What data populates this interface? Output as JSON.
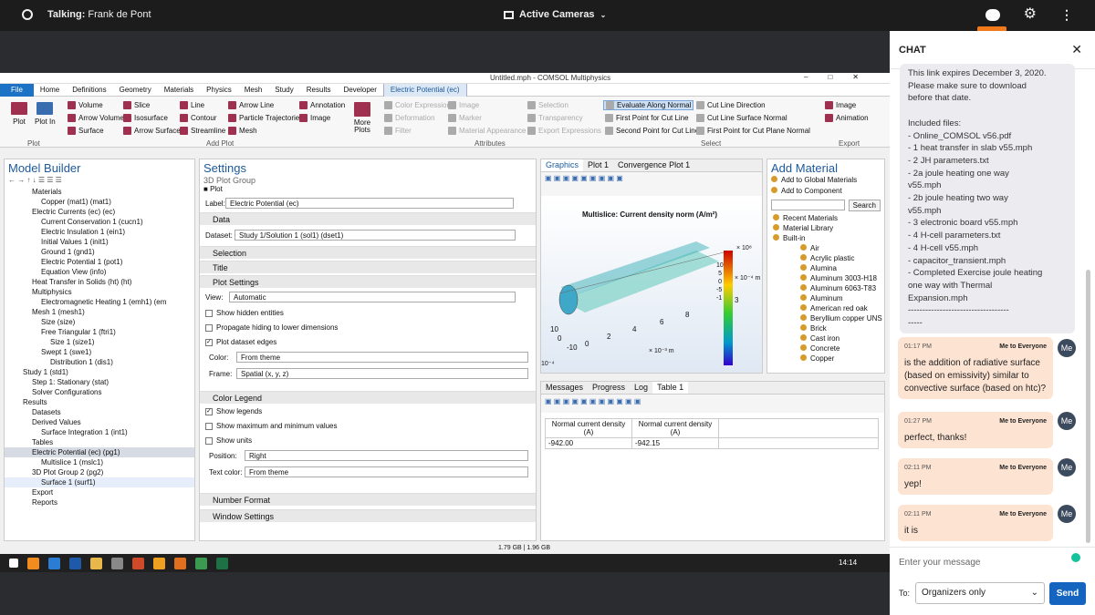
{
  "topbar": {
    "talking_label": "Talking:",
    "talking_name": "Frank de Pont",
    "cameras": "Active Cameras"
  },
  "comsol": {
    "title": "Untitled.mph - COMSOL Multiphysics",
    "menu": [
      "File",
      "Home",
      "Definitions",
      "Geometry",
      "Materials",
      "Physics",
      "Mesh",
      "Study",
      "Results",
      "Developer",
      "Electric Potential (ec)"
    ],
    "ribbon": {
      "plot": "Plot",
      "plot_in": "Plot In",
      "group_plot": "Plot",
      "add_plot": [
        "Volume",
        "Slice",
        "Line",
        "Arrow Line",
        "Annotation",
        "Arrow Volume",
        "Isosurface",
        "Contour",
        "Particle Trajectories",
        "Image",
        "Surface",
        "Arrow Surface",
        "Streamline",
        "Mesh"
      ],
      "more_plots": "More Plots",
      "group_add_plot": "Add Plot",
      "attributes": [
        "Color Expression",
        "Image",
        "Deformation",
        "Marker",
        "Filter",
        "Material Appearance",
        "Selection",
        "Transparency",
        "Export Expressions"
      ],
      "group_attributes": "Attributes",
      "select": [
        "Evaluate Along Normal",
        "Cut Line Direction",
        "First Point for Cut Line",
        "Cut Line Surface Normal",
        "Second Point for Cut Line",
        "First Point for Cut Plane Normal"
      ],
      "group_select": "Select",
      "export": [
        "Image",
        "Animation"
      ],
      "group_export": "Export"
    },
    "model_builder": {
      "title": "Model Builder",
      "items": [
        "Materials",
        "Copper (mat1) (mat1)",
        "Electric Currents (ec) (ec)",
        "Current Conservation 1 (cucn1)",
        "Electric Insulation 1 (ein1)",
        "Initial Values 1 (init1)",
        "Ground 1 (gnd1)",
        "Electric Potential 1 (pot1)",
        "Equation View (info)",
        "Heat Transfer in Solids (ht) (ht)",
        "Multiphysics",
        "Electromagnetic Heating 1 (emh1) (em",
        "Mesh 1 (mesh1)",
        "Size (size)",
        "Free Triangular 1 (ftri1)",
        "Size 1 (size1)",
        "Swept 1 (swe1)",
        "Distribution 1 (dis1)",
        "Study 1 (std1)",
        "Step 1: Stationary (stat)",
        "Solver Configurations",
        "Results",
        "Datasets",
        "Derived Values",
        "Surface Integration 1 (int1)",
        "Tables",
        "Electric Potential (ec) (pg1)",
        "Multislice 1 (mslc1)",
        "3D Plot Group 2 (pg2)",
        "Surface 1 (surf1)",
        "Export",
        "Reports"
      ]
    },
    "settings": {
      "title": "Settings",
      "subtitle": "3D Plot Group",
      "node": "Plot",
      "label_key": "Label:",
      "label_val": "Electric Potential (ec)",
      "sec_data": "Data",
      "dataset_key": "Dataset:",
      "dataset_val": "Study 1/Solution 1 (sol1) (dset1)",
      "sec_selection": "Selection",
      "sec_title": "Title",
      "sec_plot_settings": "Plot Settings",
      "view_key": "View:",
      "view_val": "Automatic",
      "show_hidden": "Show hidden entities",
      "propagate": "Propagate hiding to lower dimensions",
      "plot_edges": "Plot dataset edges",
      "color_key": "Color:",
      "color_val": "From theme",
      "frame_key": "Frame:",
      "frame_val": "Spatial  (x, y, z)",
      "sec_color_legend": "Color Legend",
      "show_legends": "Show legends",
      "show_maxmin": "Show maximum and minimum values",
      "show_units": "Show units",
      "position_key": "Position:",
      "position_val": "Right",
      "textcolor_key": "Text color:",
      "textcolor_val": "From theme",
      "sec_number_format": "Number Format",
      "sec_window_settings": "Window Settings"
    },
    "graphics": {
      "tabs": [
        "Graphics",
        "Plot 1",
        "Convergence Plot 1"
      ],
      "plot_title": "Multislice: Current density norm (A/m²)",
      "legend_exp": "× 10⁸",
      "legend_ticks": [
        "10",
        "5",
        "0",
        "-5",
        "-1"
      ],
      "axis_ticks": [
        "10",
        "0",
        "-10",
        "8",
        "6",
        "4",
        "2",
        "0",
        "3",
        "× 10⁻⁴ m",
        "× 10⁻³ m",
        "10⁻⁴"
      ]
    },
    "add_material": {
      "title": "Add Material",
      "to_global": "Add to Global Materials",
      "to_component": "Add to Component",
      "search": "Search",
      "items": [
        "Recent Materials",
        "Material Library",
        "Built-in",
        "Air",
        "Acrylic plastic",
        "Alumina",
        "Aluminum 3003-H18",
        "Aluminum 6063-T83",
        "Aluminum",
        "American red oak",
        "Beryllium copper UNS",
        "Brick",
        "Cast iron",
        "Concrete",
        "Copper"
      ]
    },
    "bottom": {
      "tabs": [
        "Messages",
        "Progress",
        "Log",
        "Table 1"
      ],
      "col1": "Normal current density (A)",
      "col2": "Normal current density (A)",
      "val1": "-942.00",
      "val2": "-942.15"
    },
    "status": "1.79 GB | 1.96 GB"
  },
  "taskbar": {
    "time": "14:14"
  },
  "chat": {
    "title": "CHAT",
    "system_lines": [
      "This link expires December 3, 2020.",
      "Please make sure to download",
      "before that date.",
      "",
      "Included files:",
      "- Online_COMSOL v56.pdf",
      "- 1 heat transfer in slab v55.mph",
      "- 2 JH parameters.txt",
      "- 2a joule heating one way",
      "v55.mph",
      "- 2b joule heating two way",
      "v55.mph",
      "- 3 electronic board v55.mph",
      "- 4 H-cell parameters.txt",
      "- 4 H-cell v55.mph",
      "- capacitor_transient.mph",
      "- Completed Exercise joule heating",
      "one way with Thermal",
      "Expansion.mph",
      "-----------------------------------",
      "-----"
    ],
    "messages": [
      {
        "time": "01:17 PM",
        "from": "Me",
        "to": "to Everyone",
        "text": "is the addition of radiative surface (based on emissivity) similar to convective surface (based on htc)?",
        "avatar": "Me"
      },
      {
        "time": "01:27 PM",
        "from": "Me",
        "to": "to Everyone",
        "text": "perfect, thanks!",
        "avatar": "Me"
      },
      {
        "time": "02:11 PM",
        "from": "Me",
        "to": "to Everyone",
        "text": "yep!",
        "avatar": "Me"
      },
      {
        "time": "02:11 PM",
        "from": "Me",
        "to": "to Everyone",
        "text": "it is",
        "avatar": "Me"
      }
    ],
    "input_placeholder": "Enter your message",
    "to_label": "To:",
    "to_value": "Organizers only",
    "send": "Send"
  }
}
